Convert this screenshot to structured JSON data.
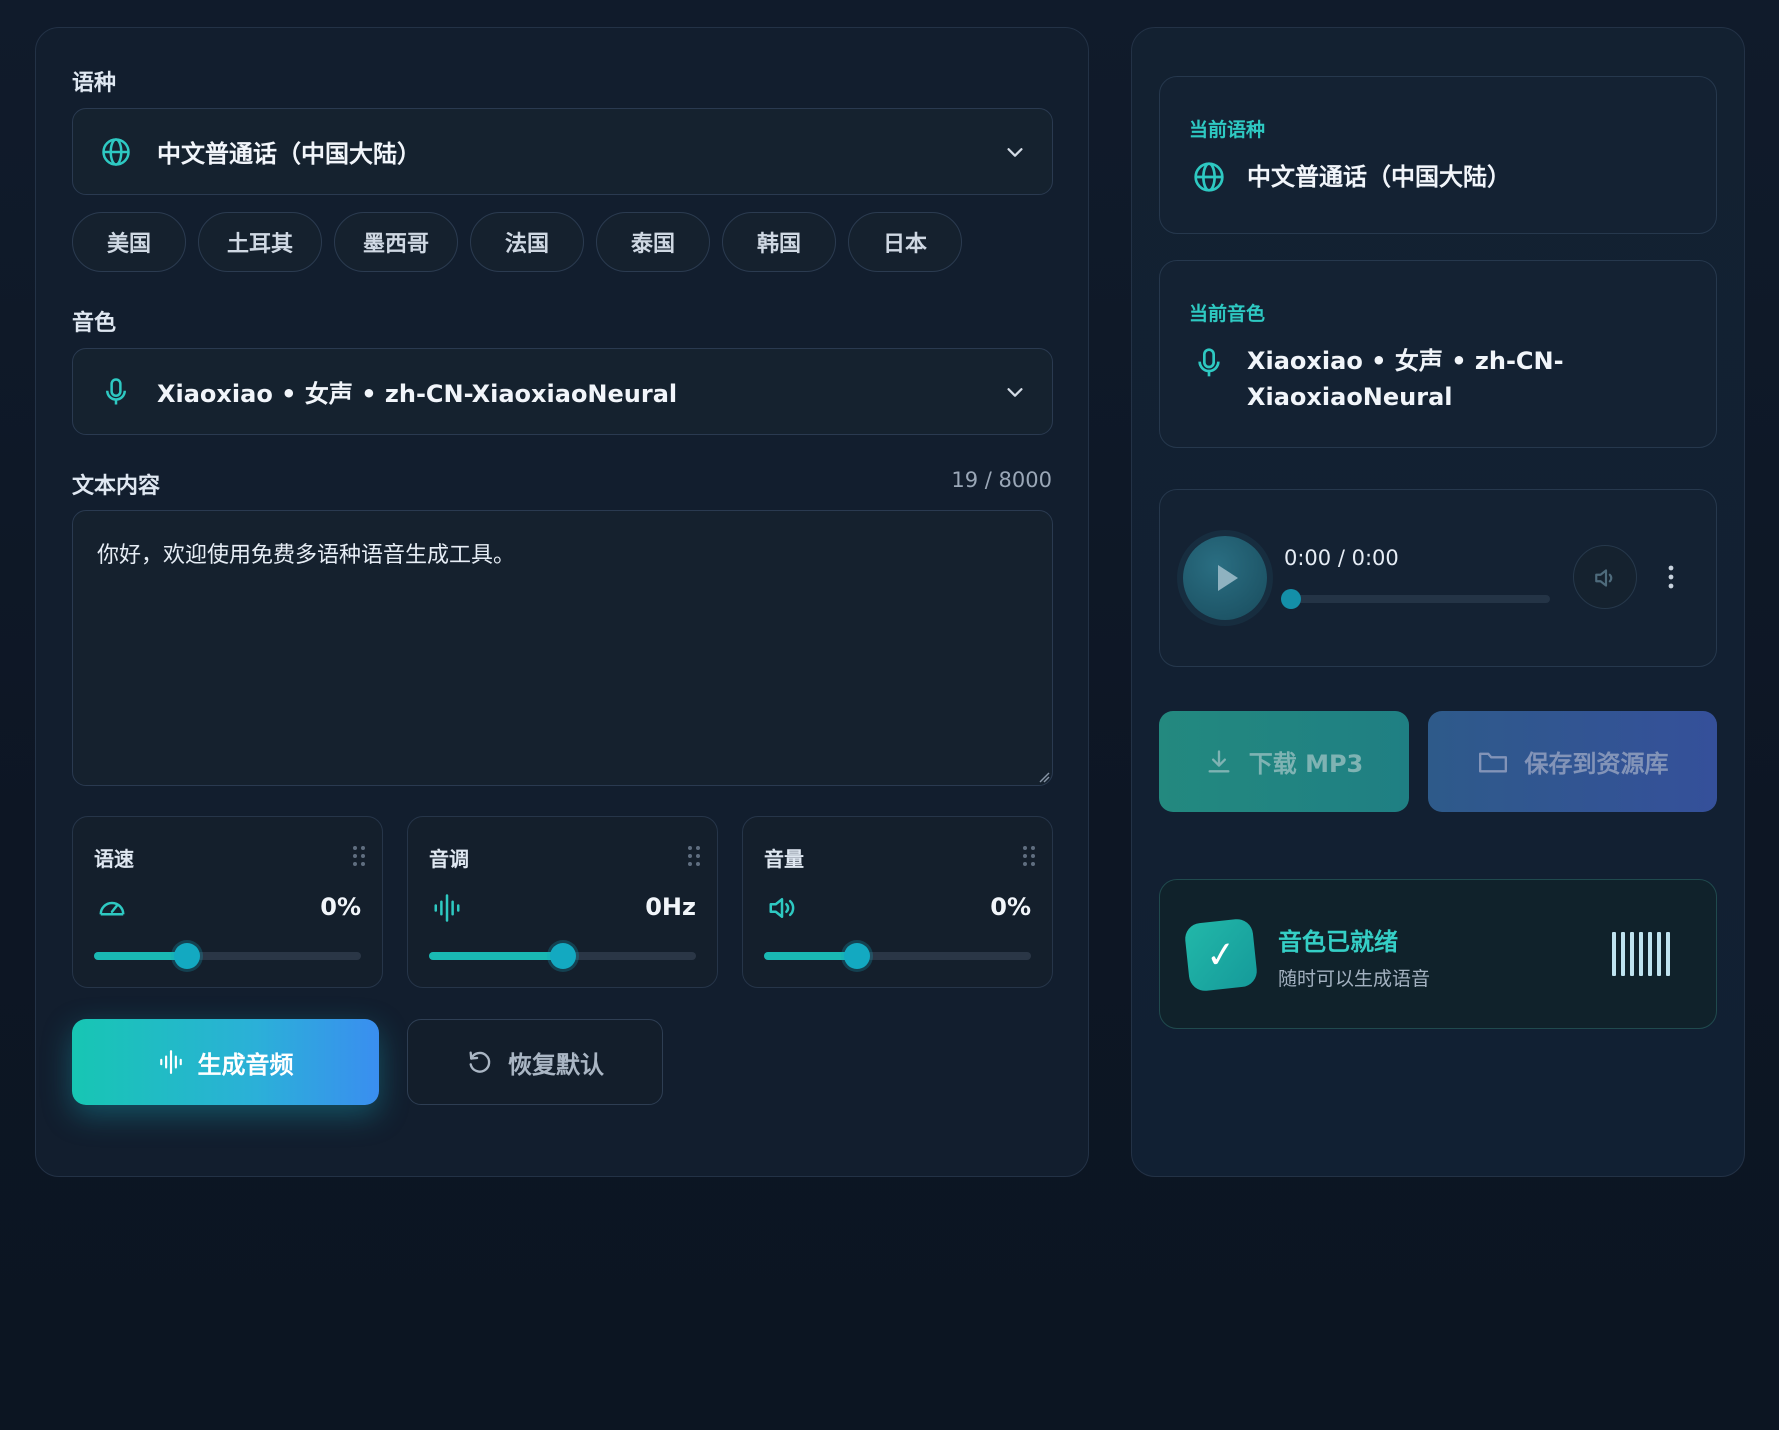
{
  "form": {
    "language_label": "语种",
    "language_value": "中文普通话（中国大陆）",
    "language_chips": [
      "美国",
      "土耳其",
      "墨西哥",
      "法国",
      "泰国",
      "韩国",
      "日本"
    ],
    "voice_label": "音色",
    "voice_value": "Xiaoxiao • 女声 • zh-CN-XiaoxiaoNeural",
    "text_label": "文本内容",
    "char_count": "19 / 8000",
    "text_value": "你好，欢迎使用免费多语种语音生成工具。",
    "sliders": [
      {
        "title": "语速",
        "icon": "speedometer-icon",
        "value": "0%",
        "level": 0.35
      },
      {
        "title": "音调",
        "icon": "waveform-icon",
        "value": "0Hz",
        "level": 0.5
      },
      {
        "title": "音量",
        "icon": "speaker-icon",
        "value": "0%",
        "level": 0.35
      }
    ],
    "generate_label": "生成音频",
    "reset_label": "恢复默认"
  },
  "summary": {
    "current_language_caption": "当前语种",
    "current_language_value": "中文普通话（中国大陆）",
    "current_voice_caption": "当前音色",
    "current_voice_line1": "Xiaoxiao • 女声 • zh-CN-",
    "current_voice_line2": "XiaoxiaoNeural"
  },
  "player": {
    "time": "0:00 / 0:00",
    "progress": 0
  },
  "actions": {
    "download_label": "下载 MP3",
    "save_label": "保存到资源库"
  },
  "status": {
    "title": "音色已就绪",
    "subtitle": "随时可以生成语音",
    "check_glyph": "✓"
  },
  "colors": {
    "accent": "#19b9b3",
    "background": "#0e1726"
  }
}
